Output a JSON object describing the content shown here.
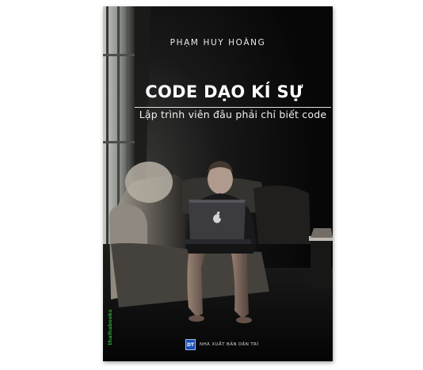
{
  "book": {
    "author": "PHẠM HUY HOÀNG",
    "title": "CODE DẠO KÍ SỰ",
    "subtitle": "Lập trình viên đâu phải chỉ biết code",
    "publisher": "NHÀ XUẤT BẢN DÂN TRÍ",
    "publisher_logo_text": "DT",
    "brand_spine": "thaihabooks"
  },
  "colors": {
    "background": "#ffffff",
    "cover": "#0d0d0e",
    "title": "#ffffff",
    "brand_green": "#2f9e3e",
    "publisher_blue": "#1c4fb3"
  },
  "illustration": {
    "description_icons": [
      "window-icon",
      "sofa-icon",
      "person-icon",
      "laptop-icon",
      "apple-logo-icon",
      "lamp-icon"
    ]
  }
}
